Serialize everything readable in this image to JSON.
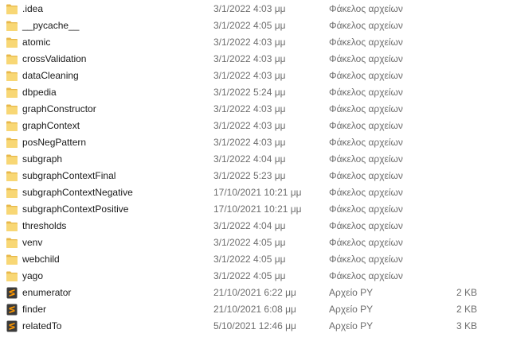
{
  "rows": [
    {
      "name": ".idea",
      "date": "3/1/2022 4:03 μμ",
      "type": "Φάκελος αρχείων",
      "size": "",
      "icon": "folder-icon"
    },
    {
      "name": "__pycache__",
      "date": "3/1/2022 4:05 μμ",
      "type": "Φάκελος αρχείων",
      "size": "",
      "icon": "folder-icon"
    },
    {
      "name": "atomic",
      "date": "3/1/2022 4:03 μμ",
      "type": "Φάκελος αρχείων",
      "size": "",
      "icon": "folder-icon"
    },
    {
      "name": "crossValidation",
      "date": "3/1/2022 4:03 μμ",
      "type": "Φάκελος αρχείων",
      "size": "",
      "icon": "folder-icon"
    },
    {
      "name": "dataCleaning",
      "date": "3/1/2022 4:03 μμ",
      "type": "Φάκελος αρχείων",
      "size": "",
      "icon": "folder-icon"
    },
    {
      "name": "dbpedia",
      "date": "3/1/2022 5:24 μμ",
      "type": "Φάκελος αρχείων",
      "size": "",
      "icon": "folder-icon"
    },
    {
      "name": "graphConstructor",
      "date": "3/1/2022 4:03 μμ",
      "type": "Φάκελος αρχείων",
      "size": "",
      "icon": "folder-icon"
    },
    {
      "name": "graphContext",
      "date": "3/1/2022 4:03 μμ",
      "type": "Φάκελος αρχείων",
      "size": "",
      "icon": "folder-icon"
    },
    {
      "name": "posNegPattern",
      "date": "3/1/2022 4:03 μμ",
      "type": "Φάκελος αρχείων",
      "size": "",
      "icon": "folder-icon"
    },
    {
      "name": "subgraph",
      "date": "3/1/2022 4:04 μμ",
      "type": "Φάκελος αρχείων",
      "size": "",
      "icon": "folder-icon"
    },
    {
      "name": "subgraphContextFinal",
      "date": "3/1/2022 5:23 μμ",
      "type": "Φάκελος αρχείων",
      "size": "",
      "icon": "folder-icon"
    },
    {
      "name": "subgraphContextNegative",
      "date": "17/10/2021 10:21 μμ",
      "type": "Φάκελος αρχείων",
      "size": "",
      "icon": "folder-icon"
    },
    {
      "name": "subgraphContextPositive",
      "date": "17/10/2021 10:21 μμ",
      "type": "Φάκελος αρχείων",
      "size": "",
      "icon": "folder-icon"
    },
    {
      "name": "thresholds",
      "date": "3/1/2022 4:04 μμ",
      "type": "Φάκελος αρχείων",
      "size": "",
      "icon": "folder-icon"
    },
    {
      "name": "venv",
      "date": "3/1/2022 4:05 μμ",
      "type": "Φάκελος αρχείων",
      "size": "",
      "icon": "folder-icon"
    },
    {
      "name": "webchild",
      "date": "3/1/2022 4:05 μμ",
      "type": "Φάκελος αρχείων",
      "size": "",
      "icon": "folder-icon"
    },
    {
      "name": "yago",
      "date": "3/1/2022 4:05 μμ",
      "type": "Φάκελος αρχείων",
      "size": "",
      "icon": "folder-icon"
    },
    {
      "name": "enumerator",
      "date": "21/10/2021 6:22 μμ",
      "type": "Αρχείο PY",
      "size": "2 KB",
      "icon": "sublime-text-file-icon"
    },
    {
      "name": "finder",
      "date": "21/10/2021 6:08 μμ",
      "type": "Αρχείο PY",
      "size": "2 KB",
      "icon": "sublime-text-file-icon"
    },
    {
      "name": "relatedTo",
      "date": "5/10/2021 12:46 μμ",
      "type": "Αρχείο PY",
      "size": "3 KB",
      "icon": "sublime-text-file-icon"
    }
  ],
  "colors": {
    "folder_body": "#F8D775",
    "folder_tab": "#E8B84A",
    "py_icon_bg": "#3B3B3B",
    "py_icon_fg": "#FF9800",
    "secondary_text": "#6D6D6D"
  }
}
